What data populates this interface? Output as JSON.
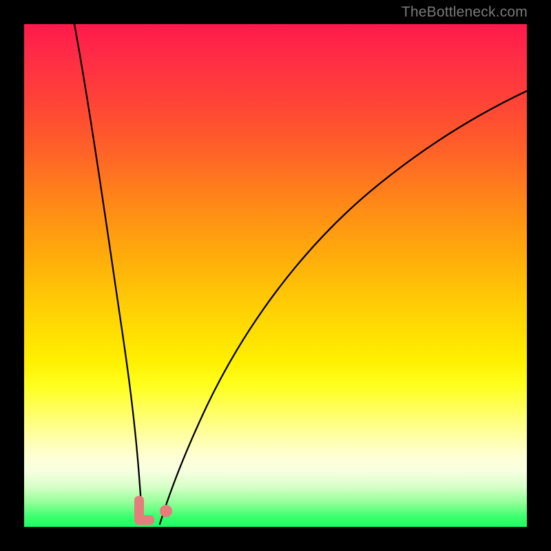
{
  "watermark": {
    "text": "TheBottleneck.com"
  },
  "chart_data": {
    "type": "line",
    "title": "",
    "xlabel": "",
    "ylabel": "",
    "xlim": [
      0,
      100
    ],
    "ylim": [
      0,
      100
    ],
    "grid": false,
    "legend": false,
    "note": "Axis values are estimated from pixel positions; chart has no visible tick labels.",
    "background_gradient": {
      "direction": "vertical",
      "stops": [
        {
          "pos": 0,
          "color": "#ff1a4b"
        },
        {
          "pos": 50,
          "color": "#ffb808"
        },
        {
          "pos": 75,
          "color": "#ffff40"
        },
        {
          "pos": 100,
          "color": "#1aff64"
        }
      ]
    },
    "series": [
      {
        "name": "left-curve",
        "color": "#000000",
        "x": [
          10,
          12,
          14,
          16,
          18,
          20,
          21.5,
          22.5,
          23.2
        ],
        "y": [
          100,
          79,
          59,
          41,
          25,
          11,
          4,
          1,
          0
        ]
      },
      {
        "name": "right-curve",
        "color": "#000000",
        "x": [
          27,
          29,
          32,
          36,
          41,
          47,
          54,
          62,
          71,
          81,
          92,
          100
        ],
        "y": [
          0,
          4,
          11,
          21,
          32,
          43,
          53,
          62,
          70,
          77,
          83,
          87
        ]
      }
    ],
    "markers": [
      {
        "name": "valley-blob",
        "shape": "L",
        "color": "#e67c7c",
        "x": 23,
        "y": 1.5,
        "size": 3.8
      },
      {
        "name": "small-dot",
        "shape": "dot",
        "color": "#e67c7c",
        "x": 28.2,
        "y": 3.2,
        "size": 1.5
      }
    ]
  }
}
